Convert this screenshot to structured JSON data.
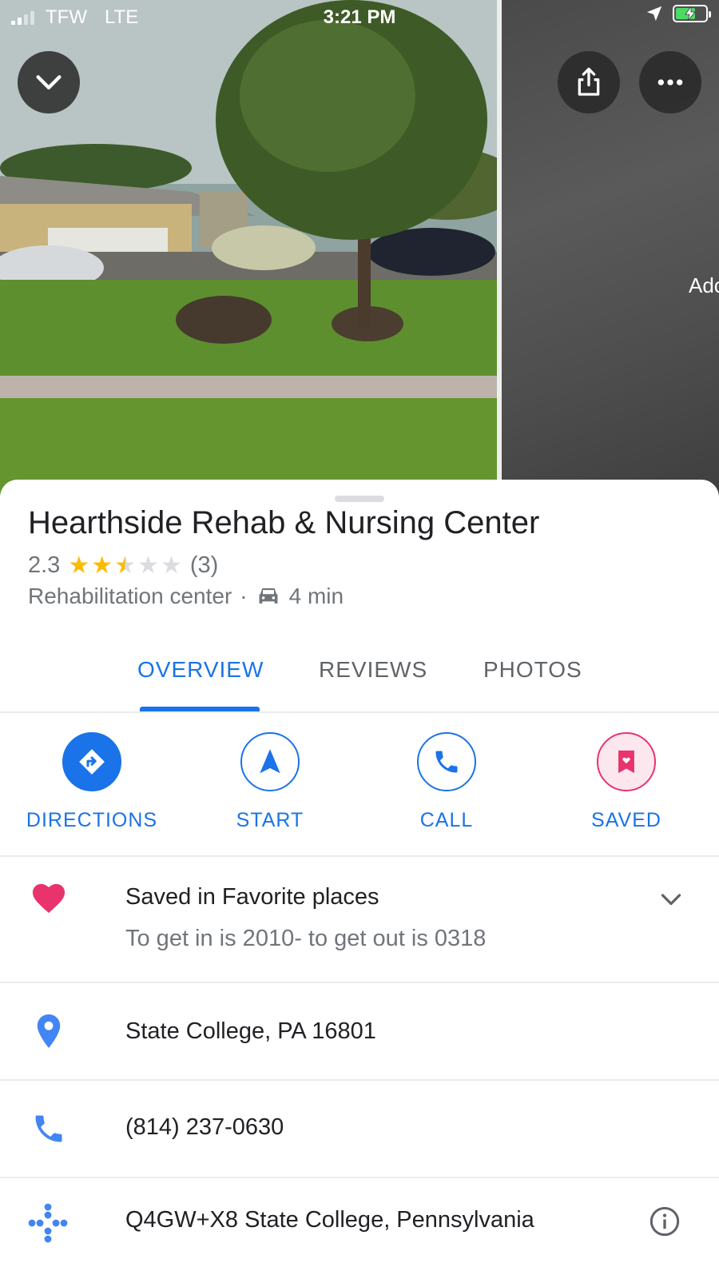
{
  "status_bar": {
    "carrier": "TFW",
    "network": "LTE",
    "time": "3:21 PM"
  },
  "photo": {
    "side_label": "Adc"
  },
  "place": {
    "title": "Hearthside Rehab & Nursing Center",
    "rating": "2.3",
    "rating_value": 2.3,
    "review_count": "(3)",
    "category": "Rehabilitation center",
    "separator": "·",
    "drive_time": "4 min"
  },
  "tabs": [
    {
      "label": "OVERVIEW",
      "active": true
    },
    {
      "label": "REVIEWS",
      "active": false
    },
    {
      "label": "PHOTOS",
      "active": false
    }
  ],
  "actions": [
    {
      "label": "DIRECTIONS",
      "icon": "directions-icon"
    },
    {
      "label": "START",
      "icon": "navigation-arrow-icon"
    },
    {
      "label": "CALL",
      "icon": "phone-icon"
    },
    {
      "label": "SAVED",
      "icon": "bookmark-heart-icon"
    }
  ],
  "saved": {
    "title": "Saved in Favorite places",
    "note": "To get in is 2010- to get out is 0318"
  },
  "address": "State College, PA 16801",
  "phone": "(814) 237-0630",
  "plus_code": "Q4GW+X8 State College, Pennsylvania",
  "colors": {
    "accent": "#1a73e8",
    "star": "#fbbc04",
    "heart": "#e8336d",
    "secondary_text": "#70757a"
  }
}
